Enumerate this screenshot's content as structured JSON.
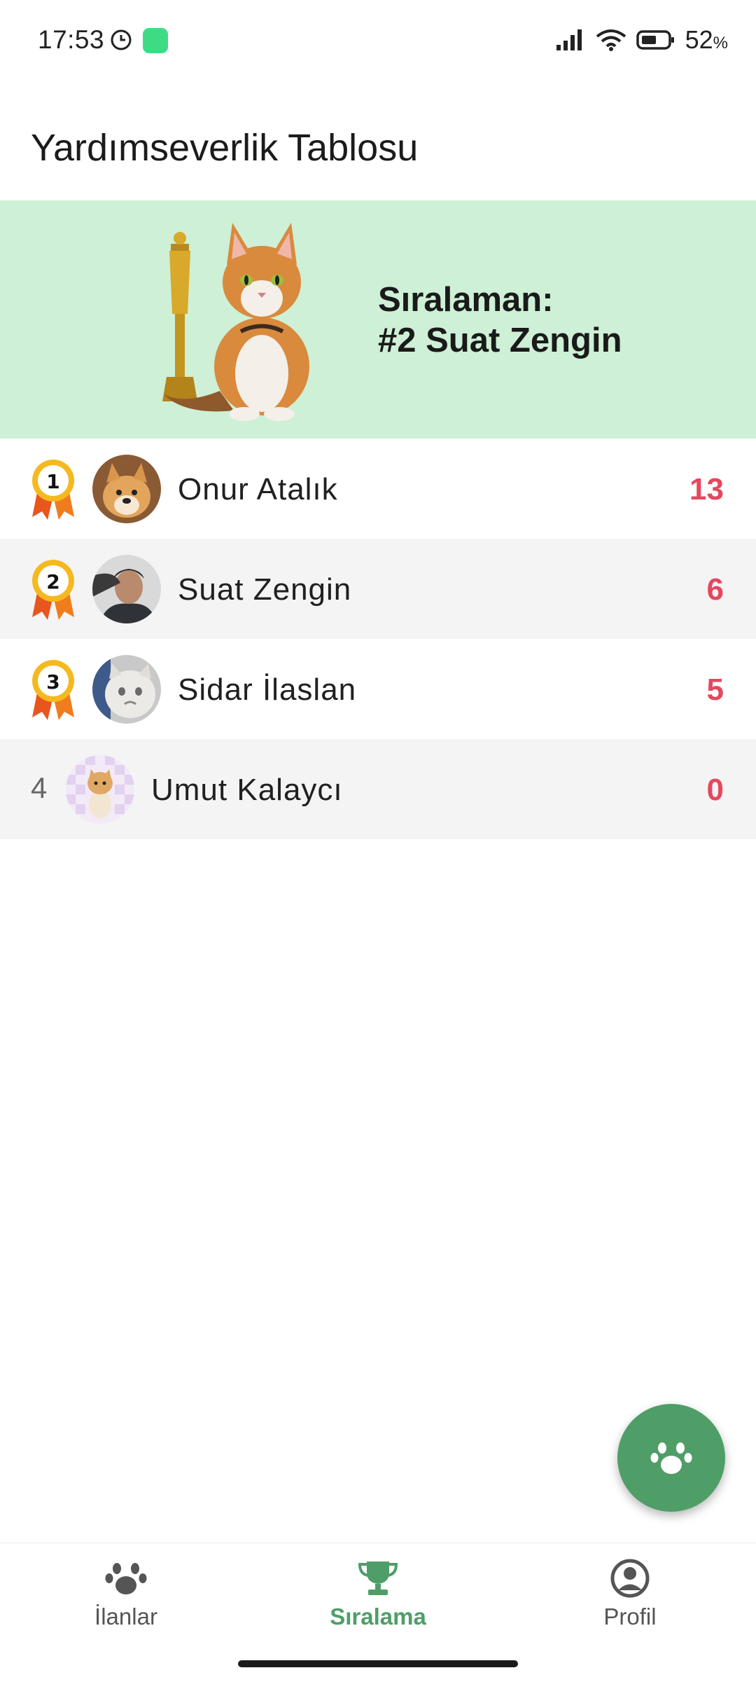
{
  "status_bar": {
    "time": "17:53",
    "battery": "52",
    "battery_unit": "%"
  },
  "page": {
    "title": "Yardımseverlik Tablosu"
  },
  "banner": {
    "rank_label": "Sıralaman:",
    "rank_value": "#2 Suat Zengin"
  },
  "leaderboard": [
    {
      "rank": "1",
      "name": "Onur Atalık",
      "score": "13"
    },
    {
      "rank": "2",
      "name": "Suat Zengin",
      "score": "6"
    },
    {
      "rank": "3",
      "name": "Sidar İlaslan",
      "score": "5"
    },
    {
      "rank": "4",
      "name": "Umut Kalaycı",
      "score": "0"
    }
  ],
  "nav": {
    "items": [
      {
        "label": "İlanlar",
        "icon": "paw-icon"
      },
      {
        "label": "Sıralama",
        "icon": "trophy-icon"
      },
      {
        "label": "Profil",
        "icon": "account-circle-icon"
      }
    ],
    "active": "Sıralama"
  },
  "colors": {
    "accent": "#4f9e68",
    "banner_bg": "#cdf0d6",
    "score": "#e5485f",
    "alt_row": "#f4f4f4"
  }
}
